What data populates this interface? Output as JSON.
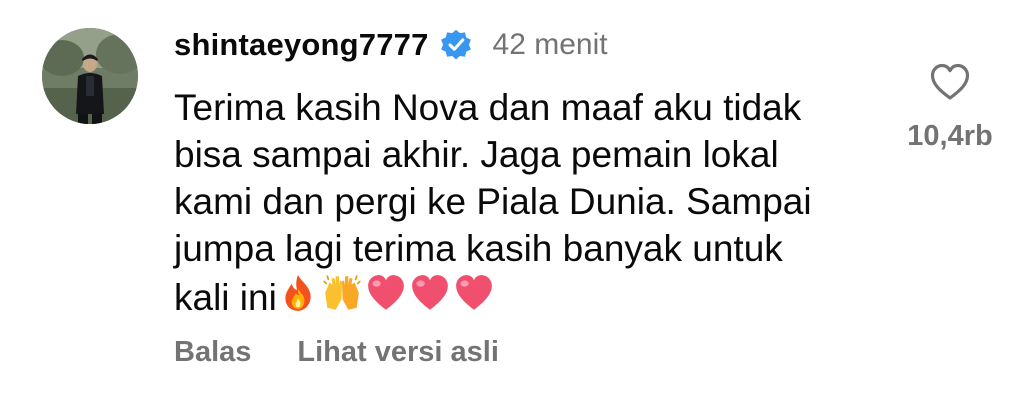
{
  "comment": {
    "username": "shintaeyong7777",
    "verified": true,
    "timestamp": "42 menit",
    "text": "Terima kasih Nova dan maaf aku tidak\nbisa sampai akhir. Jaga pemain lokal\nkami dan pergi ke Piala Dunia. Sampai\njumpa lagi terima kasih banyak untuk\nkali ini",
    "emojis": [
      "fire-emoji",
      "raising-hands-emoji",
      "heart-emoji",
      "heart-emoji",
      "heart-emoji"
    ],
    "like_count": "10,4rb",
    "actions": {
      "reply": "Balas",
      "see_original": "Lihat versi asli"
    }
  },
  "colors": {
    "text": "#0a0a0a",
    "secondary": "#737373",
    "verified_badge": "#3897f0",
    "heart_emoji": "#f0506e"
  },
  "icons": {
    "avatar": "avatar-photo",
    "badge": "verified-badge-icon",
    "like": "heart-outline-icon"
  }
}
